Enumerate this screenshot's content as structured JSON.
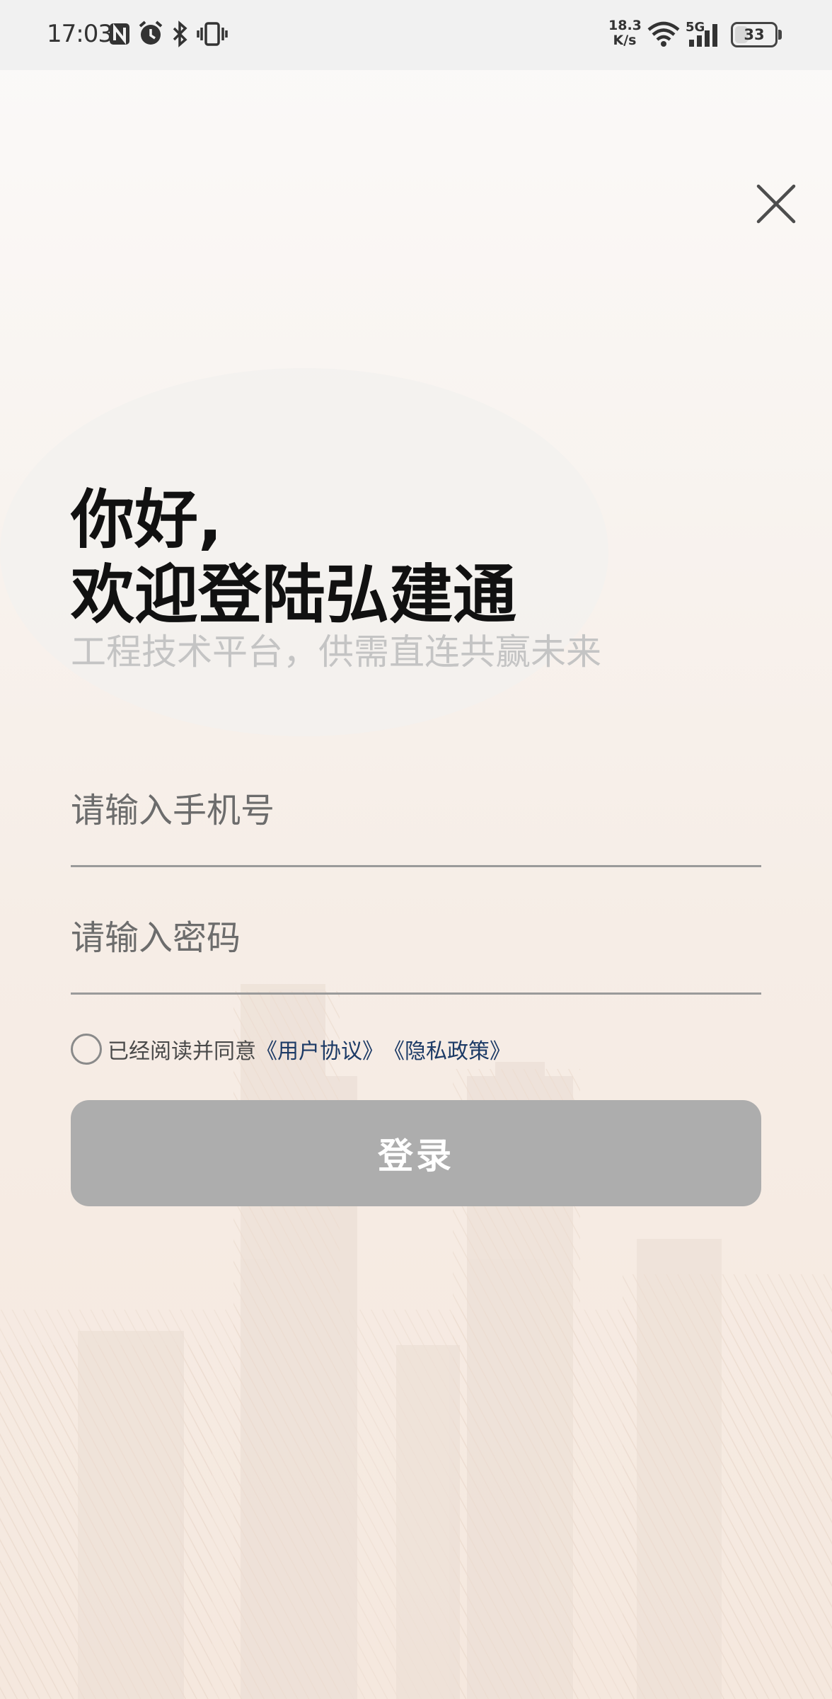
{
  "status_bar": {
    "time": "17:03",
    "net_speed_value": "18.3",
    "net_speed_unit": "K/s",
    "network_type": "5G",
    "battery": "33",
    "icons": [
      "nfc-icon",
      "alarm-icon",
      "bluetooth-icon",
      "vibrate-icon",
      "wifi-icon",
      "cellular-signal-icon",
      "battery-icon"
    ]
  },
  "header": {
    "greeting_line1": "你好,",
    "greeting_line2": "欢迎登陆弘建通",
    "subtitle": "工程技术平台，供需直连共赢未来"
  },
  "form": {
    "phone_placeholder": "请输入手机号",
    "phone_value": "",
    "password_placeholder": "请输入密码",
    "password_value": "",
    "agree_checked": false,
    "agree_text": "已经阅读并同意",
    "user_agreement_link": "《用户协议》",
    "privacy_policy_link": "《隐私政策》",
    "login_label": "登录"
  },
  "colors": {
    "login_button_disabled": "#adadad",
    "link": "#1c3a66",
    "subtitle": "#c4c4c4"
  }
}
